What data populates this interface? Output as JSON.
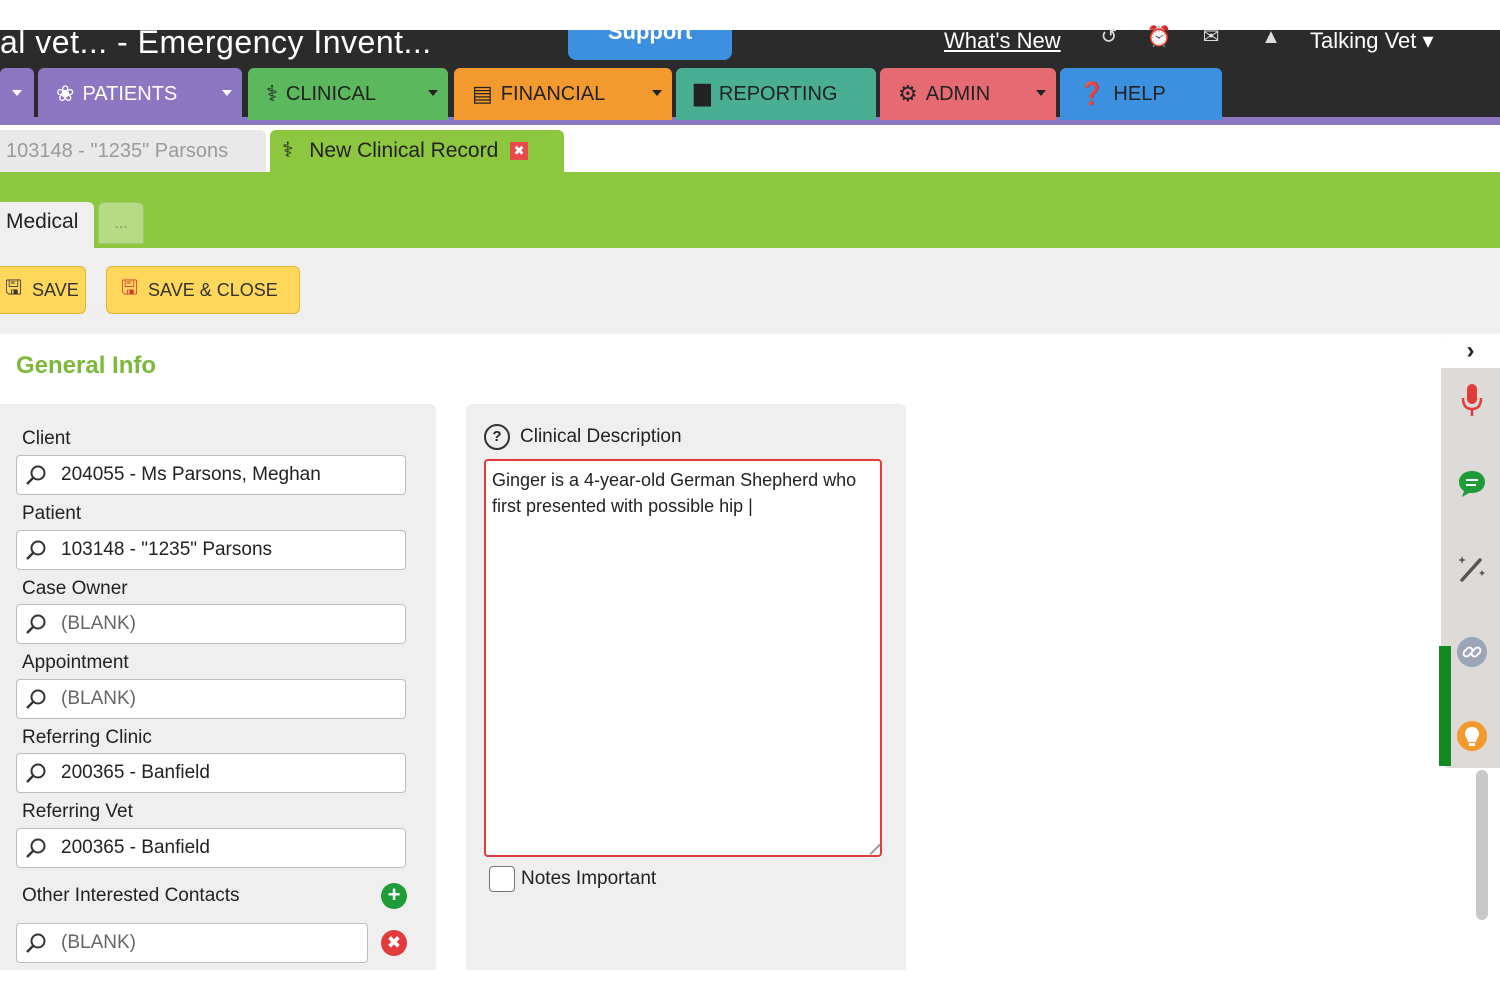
{
  "app": {
    "title": "al vet... - Emergency Invent...",
    "support_label": "Support",
    "whats_new_label": "What's New",
    "user_name": "Talking Vet"
  },
  "nav": {
    "tabs": [
      {
        "label": "PATIENTS",
        "icon": "paw-icon",
        "color": "#8c78c2"
      },
      {
        "label": "CLINICAL",
        "icon": "caduceus-icon",
        "color": "#5cb85c"
      },
      {
        "label": "FINANCIAL",
        "icon": "money-icon",
        "color": "#f39a2e"
      },
      {
        "label": "REPORTING",
        "icon": "chart-icon",
        "color": "#4aae93"
      },
      {
        "label": "ADMIN",
        "icon": "gear-icon",
        "color": "#e56a72"
      },
      {
        "label": "HELP",
        "icon": "question-icon",
        "color": "#3d8fe0"
      }
    ]
  },
  "doc_tabs": {
    "inactive_label": "103148 - \"1235\" Parsons",
    "active_label": "New Clinical Record"
  },
  "sub_tabs": {
    "medical_label": "Medical",
    "more_label": "..."
  },
  "toolbar": {
    "save_label": "SAVE",
    "save_close_label": "SAVE & CLOSE"
  },
  "general_info": {
    "title": "General Info",
    "fields": [
      {
        "label": "Client",
        "value": "204055 - Ms Parsons, Meghan"
      },
      {
        "label": "Patient",
        "value": "103148 - \"1235\" Parsons"
      },
      {
        "label": "Case Owner",
        "value": "(BLANK)"
      },
      {
        "label": "Appointment",
        "value": "(BLANK)"
      },
      {
        "label": "Referring Clinic",
        "value": "200365 - Banfield"
      },
      {
        "label": "Referring Vet",
        "value": "200365 - Banfield"
      }
    ],
    "contacts_label": "Other Interested Contacts",
    "contacts_value": "(BLANK)"
  },
  "clinical": {
    "description_label": "Clinical Description",
    "description_text": "Ginger is a 4-year-old German Shepherd who first presented with possible hip |",
    "notes_important_label": "Notes Important"
  },
  "colors": {
    "accent_green": "#8dc63f",
    "section_title": "#7cb83a",
    "button_yellow": "#fed75b",
    "error_red": "#e23b3b",
    "dark_bar": "#2b2b2b"
  },
  "side_panel": {
    "icons": [
      "chevron-right-icon",
      "microphone-icon",
      "chat-icon",
      "magic-wand-icon",
      "link-icon",
      "lightbulb-icon"
    ]
  }
}
